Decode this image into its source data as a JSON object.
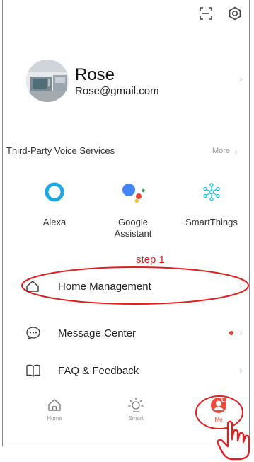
{
  "header": {
    "scan_icon": "scan-icon",
    "settings_icon": "gear-icon"
  },
  "profile": {
    "name": "Rose",
    "email": "Rose@gmail.com"
  },
  "voice_services": {
    "title": "Third-Party Voice Services",
    "more_label": "More",
    "items": [
      {
        "label": "Alexa",
        "icon": "alexa-icon"
      },
      {
        "label": "Google\nAssistant",
        "icon": "google-assistant-icon"
      },
      {
        "label": "SmartThings",
        "icon": "smartthings-icon"
      }
    ]
  },
  "annotation": {
    "step_label": "step 1",
    "color": "#e02020"
  },
  "menu": {
    "items": [
      {
        "label": "Home Management",
        "icon": "house-icon"
      },
      {
        "label": "Message Center",
        "icon": "chat-bubble-icon"
      },
      {
        "label": "FAQ & Feedback",
        "icon": "book-icon"
      }
    ]
  },
  "tabbar": {
    "items": [
      {
        "label": "Home",
        "icon": "home-icon"
      },
      {
        "label": "Smart",
        "icon": "sun-icon"
      },
      {
        "label": "Me",
        "icon": "user-icon"
      }
    ],
    "active_color": "#f0493c"
  }
}
